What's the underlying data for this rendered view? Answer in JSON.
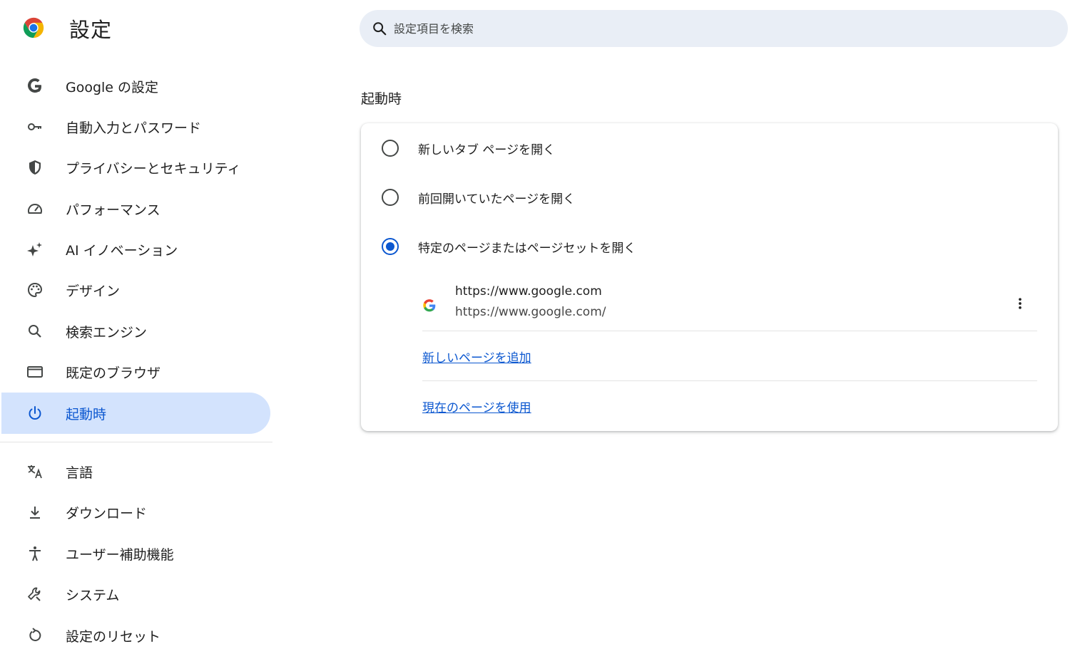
{
  "app": {
    "title": "設定"
  },
  "search": {
    "placeholder": "設定項目を検索"
  },
  "sidebar": {
    "items": [
      {
        "label": "Google の設定",
        "icon": "google-g-icon"
      },
      {
        "label": "自動入力とパスワード",
        "icon": "key-icon"
      },
      {
        "label": "プライバシーとセキュリティ",
        "icon": "shield-icon"
      },
      {
        "label": "パフォーマンス",
        "icon": "speedometer-icon"
      },
      {
        "label": "AI イノベーション",
        "icon": "sparkle-icon"
      },
      {
        "label": "デザイン",
        "icon": "palette-icon"
      },
      {
        "label": "検索エンジン",
        "icon": "search-icon"
      },
      {
        "label": "既定のブラウザ",
        "icon": "browser-window-icon"
      },
      {
        "label": "起動時",
        "icon": "power-icon",
        "active": true
      },
      {
        "label": "言語",
        "icon": "translate-icon"
      },
      {
        "label": "ダウンロード",
        "icon": "download-icon"
      },
      {
        "label": "ユーザー補助機能",
        "icon": "accessibility-icon"
      },
      {
        "label": "システム",
        "icon": "wrench-icon"
      },
      {
        "label": "設定のリセット",
        "icon": "reset-icon"
      }
    ]
  },
  "startup": {
    "title": "起動時",
    "options": [
      {
        "label": "新しいタブ ページを開く",
        "checked": false
      },
      {
        "label": "前回開いていたページを開く",
        "checked": false
      },
      {
        "label": "特定のページまたはページセットを開く",
        "checked": true
      }
    ],
    "pages": [
      {
        "title": "https://www.google.com",
        "url": "https://www.google.com/"
      }
    ],
    "add_page_label": "新しいページを追加",
    "use_current_label": "現在のページを使用"
  },
  "colors": {
    "accent": "#0b57d0",
    "active_bg": "#d3e3fd",
    "search_bg": "#e9eef6"
  }
}
